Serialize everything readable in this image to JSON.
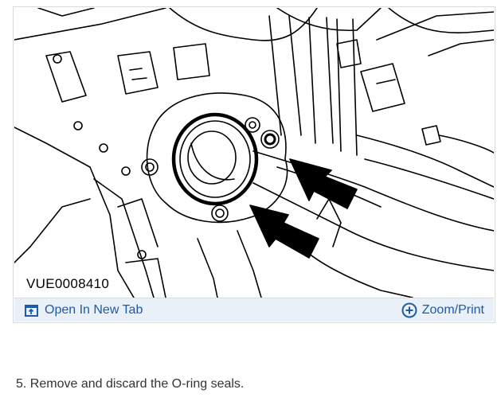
{
  "figure": {
    "code": "VUE0008410",
    "toolbar": {
      "open_label": "Open In New Tab",
      "zoom_label": "Zoom/Print",
      "open_icon": "open-new-tab-icon",
      "zoom_icon": "zoom-plus-icon",
      "accent_color": "#1f5aa6"
    }
  },
  "step": {
    "text": "5. Remove and discard the O-ring seals."
  }
}
